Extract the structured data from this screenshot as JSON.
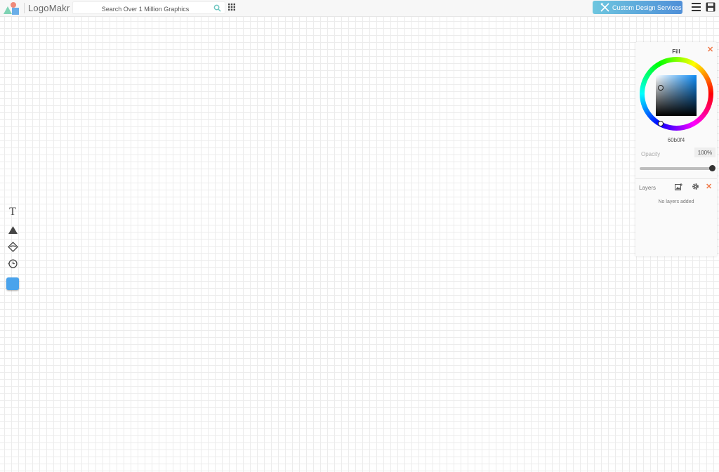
{
  "header": {
    "brand": "LogoMakr",
    "search_placeholder": "Search Over 1 Million Graphics",
    "custom_design_label": "Custom Design Services"
  },
  "toolbar": {
    "text_tool_glyph": "T",
    "swatch_color": "#4aa3ec"
  },
  "fill_panel": {
    "title": "Fill",
    "close_glyph": "✕",
    "hex": "60b0f4",
    "opacity_label": "Opacity",
    "opacity_value": "100%",
    "opacity_fraction": 1.0
  },
  "layers_panel": {
    "title": "Layers",
    "close_glyph": "✕",
    "empty_message": "No layers added"
  },
  "colors": {
    "accent_start": "#6ec6df",
    "accent_end": "#4f8fd8",
    "close_orange": "#f07a4a"
  },
  "icons": [
    "logo-icon",
    "search-icon",
    "grid-icon",
    "custom-design-icon",
    "menu-icon",
    "save-icon",
    "text-icon",
    "shape-icon",
    "icon-tool-icon",
    "history-icon",
    "add-layer-icon",
    "gear-icon",
    "close-icon"
  ]
}
